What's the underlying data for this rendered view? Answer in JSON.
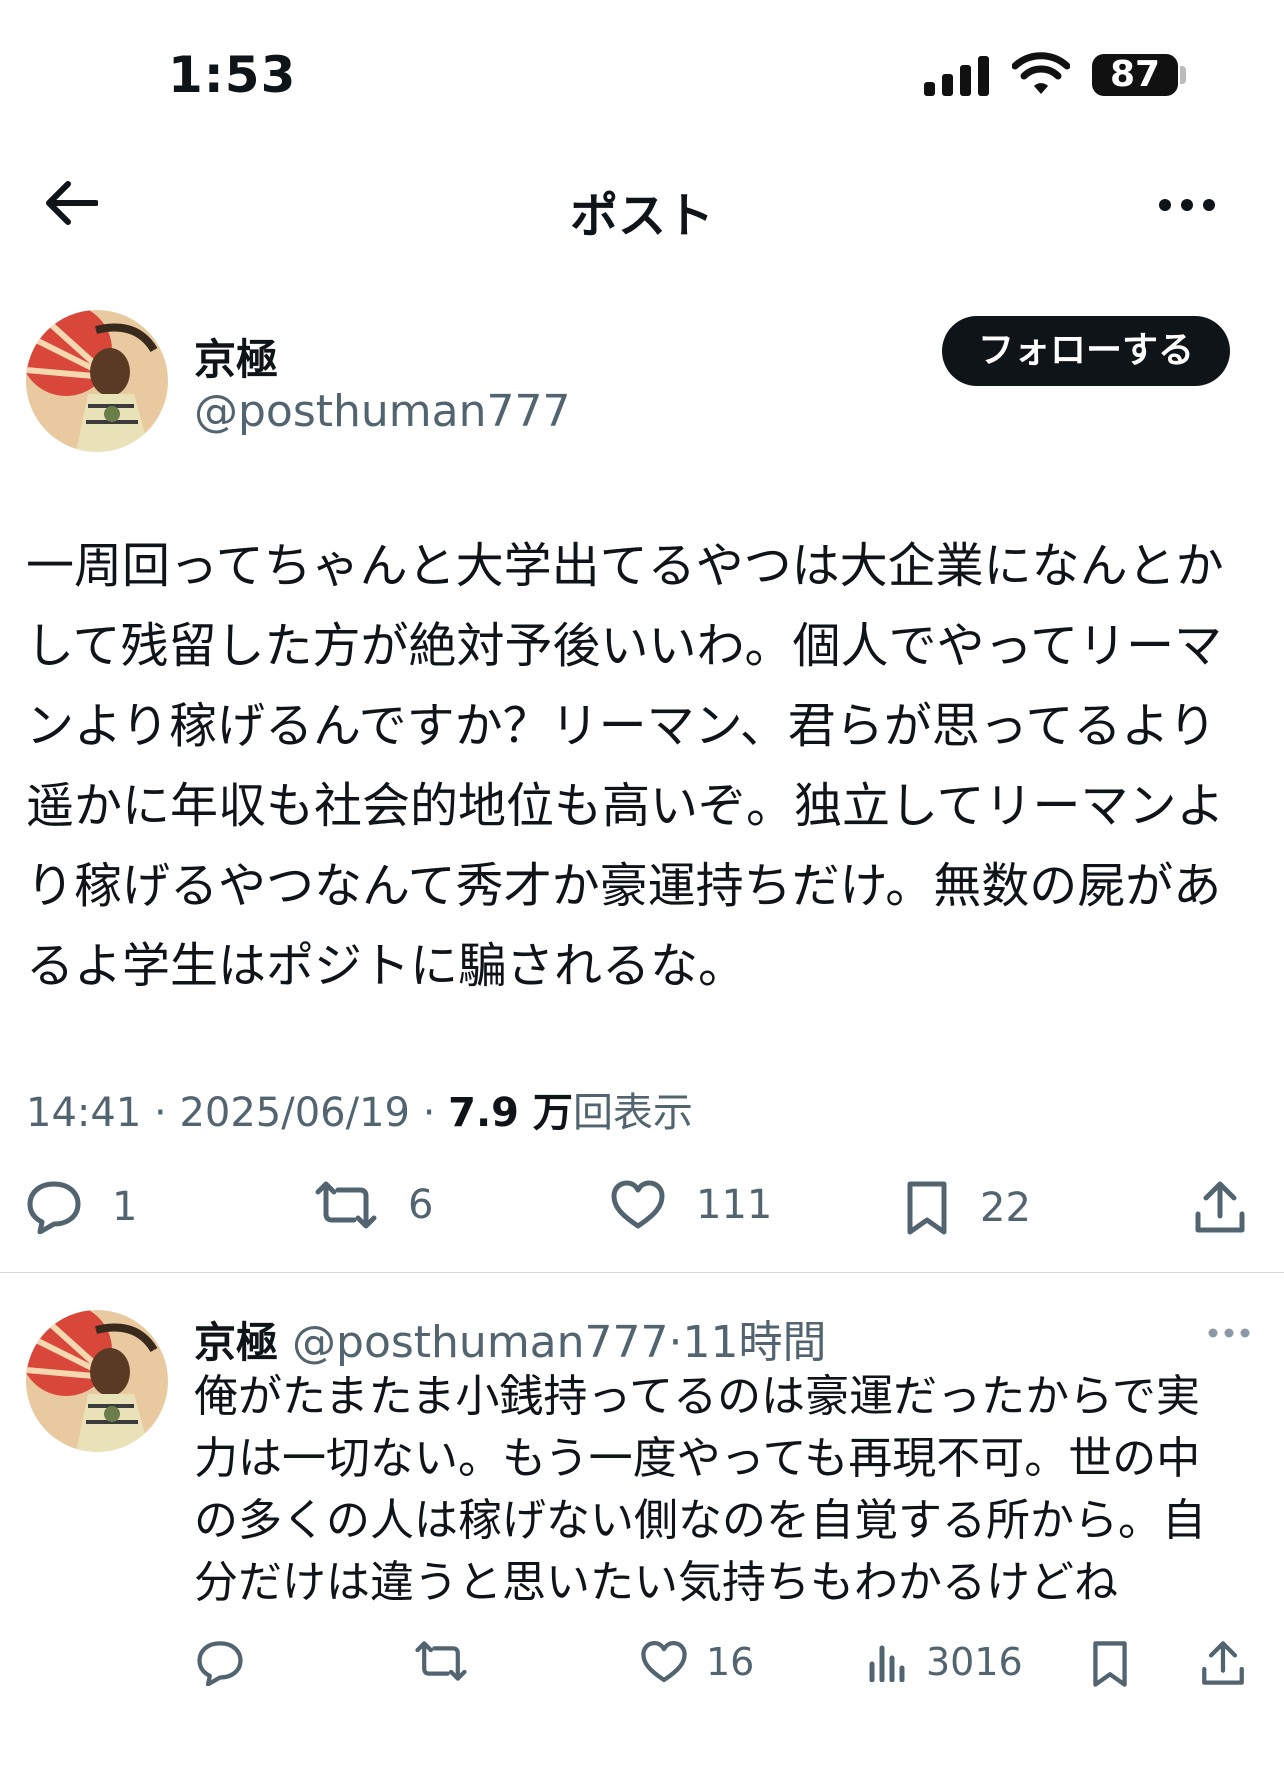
{
  "status_bar": {
    "time": "1:53",
    "battery": "87"
  },
  "nav": {
    "title": "ポスト"
  },
  "post": {
    "author_name": "京極",
    "author_handle": "@posthuman777",
    "follow_label": "フォローする",
    "body": "一周回ってちゃんと大学出てるやつは大企業になんとかして残留した方が絶対予後いいわ。個人でやってリーマンより稼げるんですか？リーマン、君らが思ってるより遥かに年収も社会的地位も高いぞ。独立してリーマンより稼げるやつなんて秀才か豪運持ちだけ。無数の屍があるよ学生はポジトに騙されるな。",
    "time": "14:41",
    "date": "2025/06/19",
    "views_count": "7.9 万",
    "views_label": "回表示",
    "sep": "·",
    "replies": "1",
    "reposts": "6",
    "likes": "111",
    "bookmarks": "22"
  },
  "reply": {
    "author_name": "京極",
    "author_handle": "@posthuman777",
    "sep": "·",
    "time_ago": "11時間",
    "body": "俺がたまたま小銭持ってるのは豪運だったからで実力は一切ない。もう一度やっても再現不可。世の中の多くの人は稼げない側なのを自覚する所から。自分だけは違うと思いたい気持ちもわかるけどね",
    "likes": "16",
    "views": "3016"
  },
  "icons": {
    "back": "back-arrow-icon",
    "more": "more-horizontal-icon",
    "reply": "reply-icon",
    "repost": "repost-icon",
    "like": "heart-icon",
    "bookmark": "bookmark-icon",
    "share": "share-icon",
    "views": "views-icon"
  },
  "colors": {
    "text": "#0f1419",
    "secondary": "#536471",
    "button_bg": "#0f1419"
  }
}
